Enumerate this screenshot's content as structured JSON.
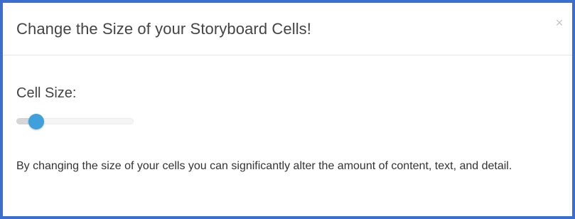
{
  "modal": {
    "title": "Change the Size of your Storyboard Cells!",
    "close_label": "×",
    "field_label": "Cell Size:",
    "slider": {
      "value_fraction": 0.17
    },
    "description": "By changing the size of your cells you can significantly alter the amount of content, text, and detail."
  },
  "colors": {
    "border": "#3a6fd0",
    "slider_thumb": "#3fa0dc",
    "title_text": "#444444"
  },
  "icons": {
    "close": "close-icon"
  }
}
